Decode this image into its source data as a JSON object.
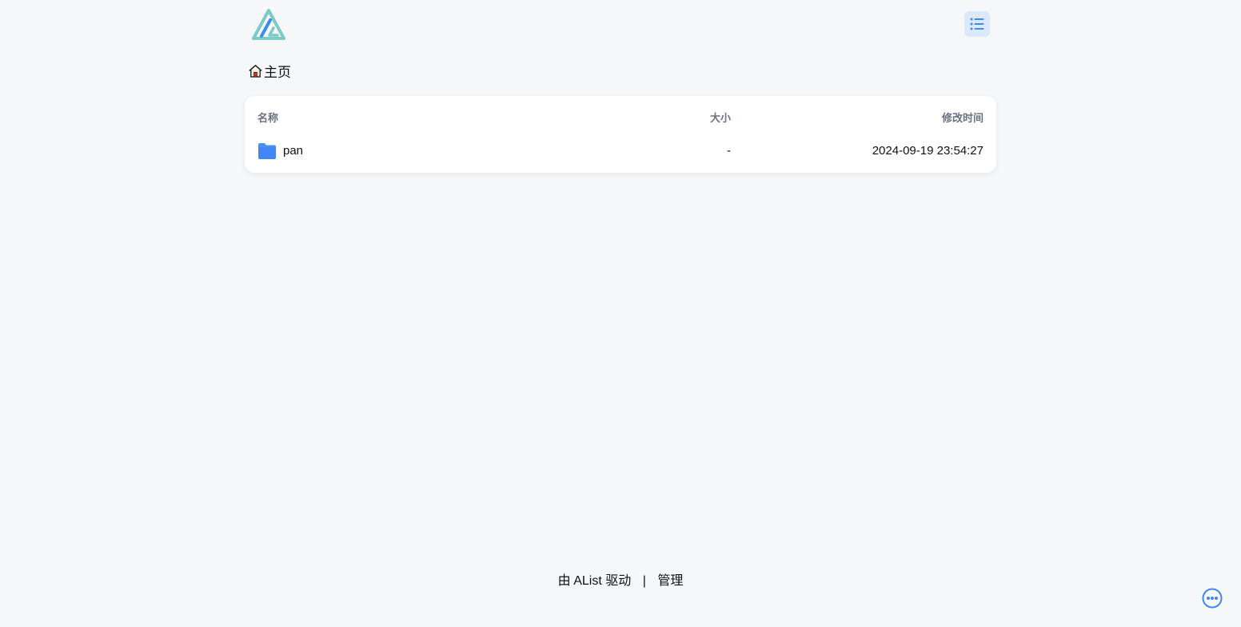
{
  "header": {
    "logo_icon": "alist-logo-icon",
    "layout_toggle_icon": "list-icon"
  },
  "breadcrumb": {
    "icon": "home-icon",
    "label": "主页"
  },
  "table": {
    "columns": {
      "name": "名称",
      "size": "大小",
      "modified": "修改时间"
    },
    "rows": [
      {
        "icon": "folder-icon",
        "name": "pan",
        "size": "-",
        "modified": "2024-09-19 23:54:27"
      }
    ]
  },
  "footer": {
    "powered_by_prefix": "由",
    "powered_by_link": "AList",
    "powered_by_suffix": "驱动",
    "separator": "|",
    "manage_link": "管理"
  },
  "floating": {
    "more_icon": "more-options-icon"
  },
  "colors": {
    "accent": "#4285f4",
    "background": "#f6f7f9",
    "layout_btn_bg": "#dce9fb",
    "logo_teal": "#7ecac5",
    "logo_blue": "#3a8ee6"
  }
}
